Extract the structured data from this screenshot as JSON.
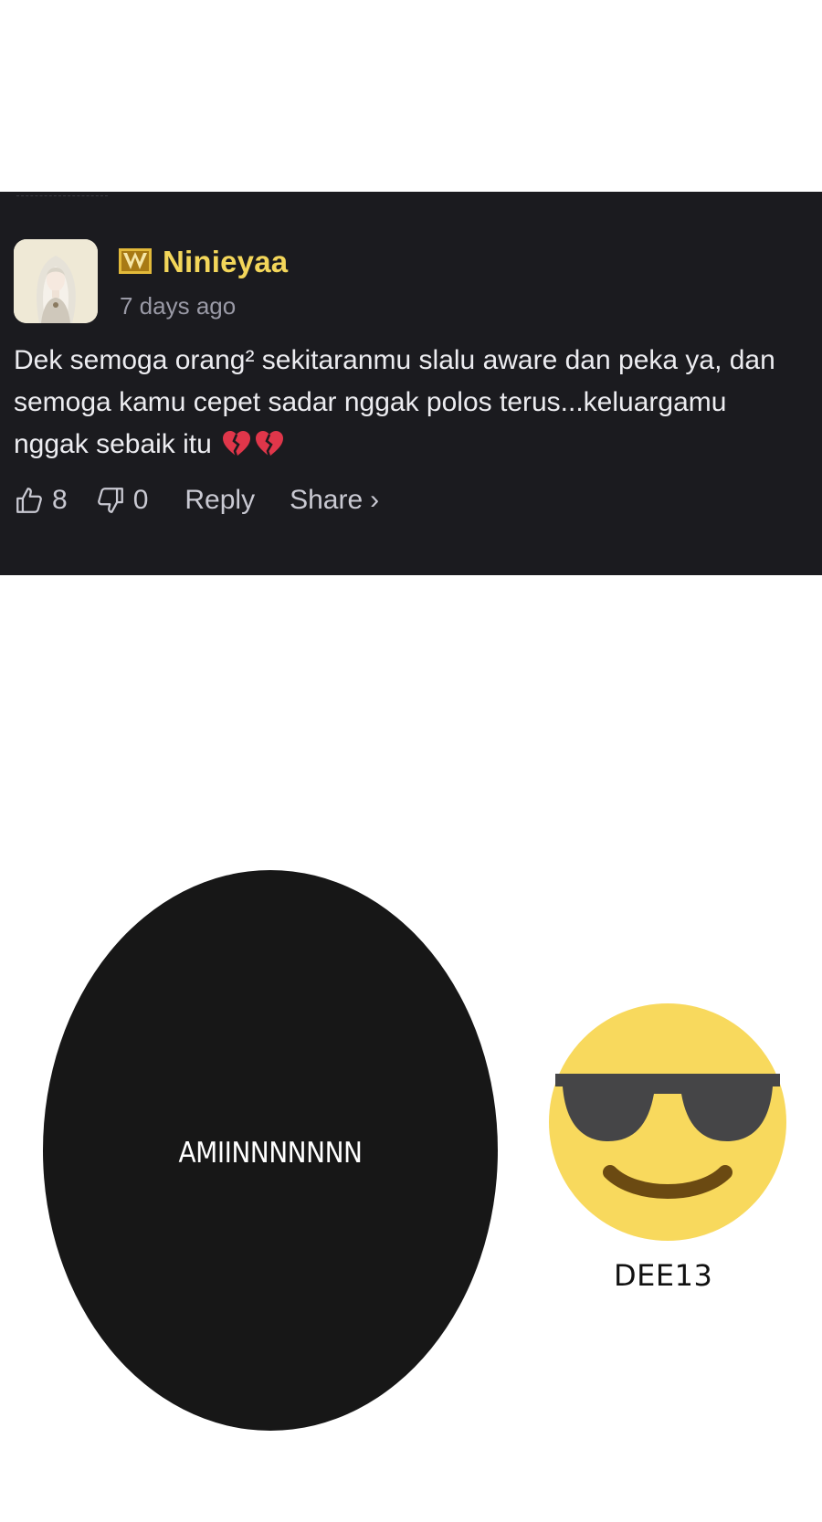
{
  "comment": {
    "username": "Ninieyaa",
    "timestamp": "7 days ago",
    "text": "Dek semoga orang² sekitaranmu slalu aware dan peka ya, dan semoga kamu cepet sadar nggak polos terus...keluargamu nggak sebaik itu",
    "like_count": "8",
    "dislike_count": "0",
    "reply_label": "Reply",
    "share_label": "Share",
    "share_chevron": "›",
    "username_color": "#f3d65a",
    "icons": [
      "avatar-image",
      "badge-icon",
      "broken-heart-icon",
      "thumbs-up-icon",
      "thumbs-down-icon"
    ]
  },
  "bubble": {
    "text": "AMIINNNNNNN"
  },
  "emoji": {
    "icon": "sunglasses-smiley-icon",
    "label": "DEE13"
  }
}
